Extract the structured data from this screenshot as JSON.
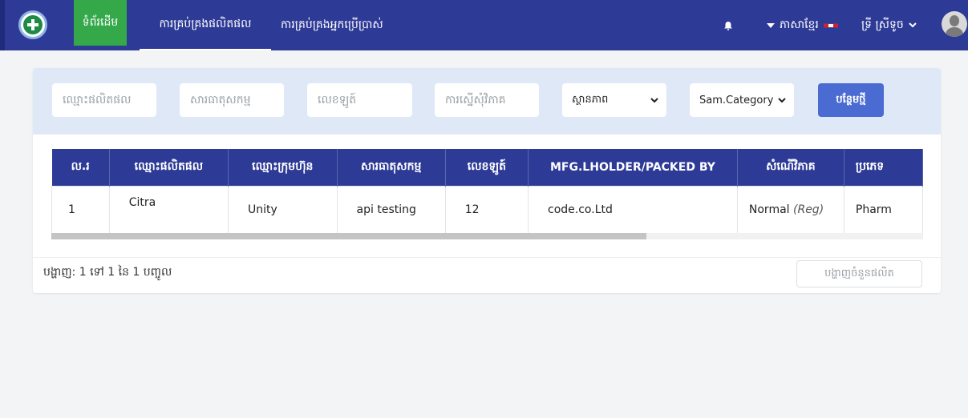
{
  "nav": {
    "home": "ទំព័រដើម",
    "products": "ការគ្រប់គ្រងផលិតផល",
    "users": "ការគ្រប់គ្រងអ្នកប្រើប្រាស់",
    "language": "ភាសាខ្មែរ",
    "user_name": "ទ្រី ស្រីទូច"
  },
  "filters": {
    "product_name_placeholder": "ឈ្មោះផលិតផល",
    "ingredient_placeholder": "សារធាតុសកម្ម",
    "lot_placeholder": "លេខឡូត៍",
    "request_placeholder": "ការស្នើសុំវិភាគ",
    "status_selected": "ស្ថានភាព",
    "category_selected": "Sam.Category",
    "add_button": "បន្ថែមថ្មី"
  },
  "table": {
    "headers": [
      "ល.រ",
      "ឈ្មោះផលិតផល",
      "ឈ្មោះក្រុមហ៊ុន",
      "សារធាតុសកម្ម",
      "លេខឡូត៍",
      "MFG.LHOLDER/PACKED BY",
      "សំណើវិភាគ",
      "ប្រភេទ"
    ],
    "rows": [
      {
        "no": "1",
        "product": "Citra",
        "company": "Unity",
        "ingredient": "api testing",
        "lot": "12",
        "mfg": "code.co.Ltd",
        "request": "Normal",
        "request_tag": "(Reg)",
        "type": "Pharm"
      }
    ]
  },
  "footer": {
    "count_text": "បង្ហាញ: 1 ទៅ 1 នៃ 1 បញ្ចូល",
    "show_button": "បង្ហាញចំនួនផលិត"
  },
  "colors": {
    "navbar": "#2d3a96",
    "home_active": "#35a84a",
    "button": "#4a6bd1",
    "filter_bg": "#dee8f6"
  }
}
